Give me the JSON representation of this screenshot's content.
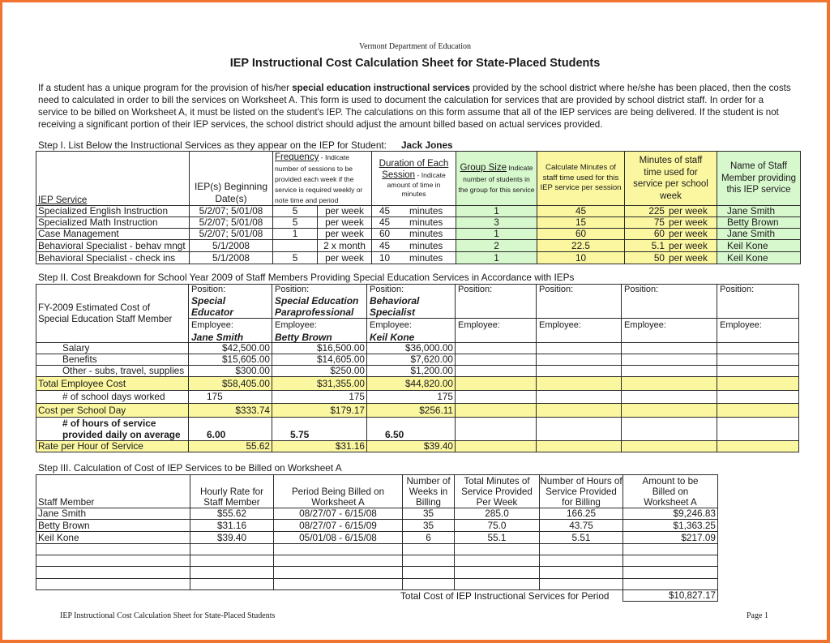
{
  "header": {
    "department": "Vermont Department of Education",
    "title": "IEP Instructional Cost Calculation Sheet for State-Placed Students",
    "intro_before_bold": "If a student has a unique program for the provision of his/her ",
    "intro_bold": "special education instructional services",
    "intro_after_bold": " provided by the school district where he/she has been placed, then the costs need to calculated in order to bill the services on Worksheet A.  This form is used to document the calculation for services that are provided by school district staff.  In order for a service to be billed on Worksheet A, it must be listed on the student's IEP.  The calculations on this form assume that all of the IEP services are being delivered.  If the student is not receiving a significant portion of their IEP services, the school district should adjust the amount billed based on actual services provided."
  },
  "step1": {
    "label": "Step I. List Below the Instructional Services as they appear on the IEP for Student:",
    "student_name": "Jack Jones",
    "headers": {
      "service": "IEP Service",
      "begin_date_line1": "IEP(s) Beginning",
      "begin_date_line2": "Date(s)",
      "frequency_title": "Frequency",
      "frequency_desc": " - Indicate number of sessions to be provided each week if the service is required weekly or note time and period",
      "duration_title_line1": "Duration of Each",
      "duration_title_line2": "Session",
      "duration_desc_a": " - Indicate",
      "duration_desc_b": "amount of time in minutes",
      "group_title": "Group Size",
      "group_desc": " Indicate number of students in the group for this service",
      "calc_minutes": "Calculate Minutes  of staff time used for this IEP service per session",
      "minutes_week": "Minutes of staff time used for service per school week",
      "staff_name": "Name of Staff Member providing this IEP service"
    },
    "rows": [
      {
        "service": "Specialized English Instruction",
        "date": "5/2/07; 5/01/08",
        "freq_num": "5",
        "freq_unit": "per week",
        "dur_num": "45",
        "dur_unit": "minutes",
        "group": "1",
        "calc_min": "45",
        "week_num": "225",
        "week_unit": "per week",
        "staff": "Jane Smith"
      },
      {
        "service": "Specialized Math Instruction",
        "date": "5/2/07; 5/01/08",
        "freq_num": "5",
        "freq_unit": "per week",
        "dur_num": "45",
        "dur_unit": "minutes",
        "group": "3",
        "calc_min": "15",
        "week_num": "75",
        "week_unit": "per week",
        "staff": "Betty Brown"
      },
      {
        "service": "Case Management",
        "date": "5/2/07; 5/01/08",
        "freq_num": "1",
        "freq_unit": "per week",
        "dur_num": "60",
        "dur_unit": "minutes",
        "group": "1",
        "calc_min": "60",
        "week_num": "60",
        "week_unit": "per week",
        "staff": "Jane Smith"
      },
      {
        "service": "Behavioral Specialist - behav mngt",
        "date": "5/1/2008",
        "freq_num": "",
        "freq_unit": "2 x month",
        "dur_num": "45",
        "dur_unit": "minutes",
        "group": "2",
        "calc_min": "22.5",
        "week_num": "5.1",
        "week_unit": "per week",
        "staff": "Keil Kone"
      },
      {
        "service": "Behavioral Specialist - check ins",
        "date": "5/1/2008",
        "freq_num": "5",
        "freq_unit": "per week",
        "dur_num": "10",
        "dur_unit": "minutes",
        "group": "1",
        "calc_min": "10",
        "week_num": "50",
        "week_unit": "per week",
        "staff": "Keil Kone"
      }
    ]
  },
  "step2": {
    "label": "Step II. Cost Breakdown for School Year 2009 of Staff Members Providing Special Education Services in Accordance with IEPs",
    "corner_label": "FY-2009 Estimated Cost of Special Education Staff Member",
    "position_label": "Position:",
    "employee_label": "Employee:",
    "row_labels": {
      "salary": "Salary",
      "benefits": "Benefits",
      "other": "Other - subs, travel, supplies",
      "total": "Total Employee Cost",
      "days": "# of school days worked",
      "cost_day": "Cost per School Day",
      "hours_line1": "# of hours of service",
      "hours_line2": "provided daily on average",
      "rate": "Rate per Hour of Service"
    },
    "staff": [
      {
        "position": "Special Educator",
        "employee": "Jane Smith",
        "salary": "$42,500.00",
        "benefits": "$15,605.00",
        "other": "$300.00",
        "total": "$58,405.00",
        "days": "175",
        "cost_day": "$333.74",
        "hours": "6.00",
        "rate": "55.62"
      },
      {
        "position": "Special Education Paraprofessional",
        "employee": "Betty Brown",
        "salary": "$16,500.00",
        "benefits": "$14,605.00",
        "other": "$250.00",
        "total": "$31,355.00",
        "days": "175",
        "cost_day": "$179.17",
        "hours": "5.75",
        "rate": "$31.16"
      },
      {
        "position": "Behavioral Specialist",
        "employee": "Keil Kone",
        "salary": "$36,000.00",
        "benefits": "$7,620.00",
        "other": "$1,200.00",
        "total": "$44,820.00",
        "days": "175",
        "cost_day": "$256.11",
        "hours": "6.50",
        "rate": "$39.40"
      },
      {
        "position": "",
        "employee": "",
        "salary": "",
        "benefits": "",
        "other": "",
        "total": "",
        "days": "",
        "cost_day": "",
        "hours": "",
        "rate": ""
      },
      {
        "position": "",
        "employee": "",
        "salary": "",
        "benefits": "",
        "other": "",
        "total": "",
        "days": "",
        "cost_day": "",
        "hours": "",
        "rate": ""
      },
      {
        "position": "",
        "employee": "",
        "salary": "",
        "benefits": "",
        "other": "",
        "total": "",
        "days": "",
        "cost_day": "",
        "hours": "",
        "rate": ""
      },
      {
        "position": "",
        "employee": "",
        "salary": "",
        "benefits": "",
        "other": "",
        "total": "",
        "days": "",
        "cost_day": "",
        "hours": "",
        "rate": ""
      }
    ]
  },
  "step3": {
    "label": "Step III.  Calculation of Cost of IEP Services to be Billed on Worksheet A",
    "headers": {
      "staff": "Staff Member",
      "rate": "Hourly Rate for Staff Member",
      "period": "Period Being Billed on Worksheet A",
      "weeks": "Number of Weeks in Billing",
      "minutes": "Total Minutes of Service Provided Per Week",
      "hours": "Number of Hours of Service Provided for Billing",
      "amount": "Amount to be Billed on Worksheet A"
    },
    "rows": [
      {
        "staff": "Jane Smith",
        "rate": "$55.62",
        "period": "08/27/07 - 6/15/08",
        "weeks": "35",
        "minutes": "285.0",
        "hours": "166.25",
        "amount": "$9,246.83"
      },
      {
        "staff": "Betty Brown",
        "rate": "$31.16",
        "period": "08/27/07 - 6/15/09",
        "weeks": "35",
        "minutes": "75.0",
        "hours": "43.75",
        "amount": "$1,363.25"
      },
      {
        "staff": "Keil Kone",
        "rate": "$39.40",
        "period": "05/01/08 - 6/15/08",
        "weeks": "6",
        "minutes": "55.1",
        "hours": "5.51",
        "amount": "$217.09"
      },
      {
        "staff": "",
        "rate": "",
        "period": "",
        "weeks": "",
        "minutes": "",
        "hours": "",
        "amount": ""
      },
      {
        "staff": "",
        "rate": "",
        "period": "",
        "weeks": "",
        "minutes": "",
        "hours": "",
        "amount": ""
      },
      {
        "staff": "",
        "rate": "",
        "period": "",
        "weeks": "",
        "minutes": "",
        "hours": "",
        "amount": ""
      },
      {
        "staff": "",
        "rate": "",
        "period": "",
        "weeks": "",
        "minutes": "",
        "hours": "",
        "amount": ""
      }
    ],
    "total_label": "Total Cost of IEP Instructional Services for Period",
    "total_value": "$10,827.17"
  },
  "footer": {
    "left": "IEP Instructional Cost Calculation Sheet for State-Placed Students",
    "right": "Page  1"
  },
  "colors": {
    "frame": "#f07430",
    "green_fill": "#d7f7cd",
    "yellow_fill": "#fbf7a0"
  }
}
